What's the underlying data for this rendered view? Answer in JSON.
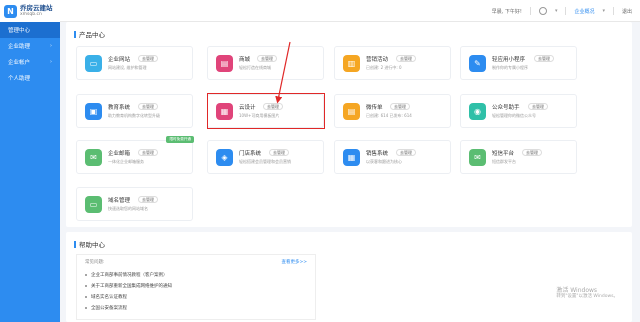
{
  "brand": {
    "name": "乔房云建站",
    "sub": "xmsqb.cn",
    "badge": "N"
  },
  "topbar": {
    "greeting": "早晨, 下午好!",
    "account": "企业概况",
    "logout": "退出"
  },
  "sidebar": {
    "items": [
      {
        "label": "管理中心",
        "arrow": ""
      },
      {
        "label": "企业助理",
        "arrow": "›"
      },
      {
        "label": "企业帐户",
        "arrow": "›"
      },
      {
        "label": "个人助理",
        "arrow": ""
      }
    ]
  },
  "products": {
    "title": "产品中心",
    "manage_label": "去管理",
    "cards": [
      {
        "name": "企业网站",
        "desc": "网站建设, 维护和管理",
        "color": "#3ab0e8",
        "icon": "▭"
      },
      {
        "name": "商城",
        "desc": "轻松打造在线商城",
        "color": "#e0447a",
        "icon": "▤"
      },
      {
        "name": "营销活动",
        "desc": "已创建: 2  进行中: 0",
        "color": "#f5a623",
        "icon": "▥"
      },
      {
        "name": "轻应用小程序",
        "desc": "制作你的专属小程序",
        "color": "#2d8cf0",
        "icon": "✎"
      },
      {
        "name": "教育系统",
        "desc": "助力教育机构数字化转型升级",
        "color": "#2d8cf0",
        "icon": "▣"
      },
      {
        "name": "云设计",
        "desc": "10W+可商用模板图片",
        "color": "#e0447a",
        "icon": "▦"
      },
      {
        "name": "微传单",
        "desc": "已创建: 614  已发布: 614",
        "color": "#f5a623",
        "icon": "▤"
      },
      {
        "name": "公众号助手",
        "desc": "轻松管理你的微信公众号",
        "color": "#2fc0a8",
        "icon": "◉"
      },
      {
        "name": "企业邮箱",
        "desc": "一体化企业邮箱服务",
        "color": "#5bbd72",
        "icon": "✉",
        "ribbon": "限时免费开通"
      },
      {
        "name": "门店系统",
        "desc": "轻松搭建会员管理和会员营销",
        "color": "#2d8cf0",
        "icon": "◈"
      },
      {
        "name": "销售系统",
        "desc": "以获客和跟进为核心",
        "color": "#2d8cf0",
        "icon": "▦"
      },
      {
        "name": "短信平台",
        "desc": "短信群发平台",
        "color": "#5bbd72",
        "icon": "✉"
      },
      {
        "name": "域名管理",
        "desc": "快速选取您的网站域名",
        "color": "#5bbd72",
        "icon": "▭"
      }
    ]
  },
  "help": {
    "title": "帮助中心",
    "faq_label": "常见问题:",
    "more_label": "查看更多>>",
    "items": [
      "企业工商部事前情况教程（客户案例）",
      "关于工商部重新全国集成网络维护的通知",
      "域名实名认证教程",
      "全国公安备案流程"
    ]
  },
  "watermark": {
    "line1": "激活 Windows",
    "line2": "转到\"设置\"以激活 Windows。"
  }
}
